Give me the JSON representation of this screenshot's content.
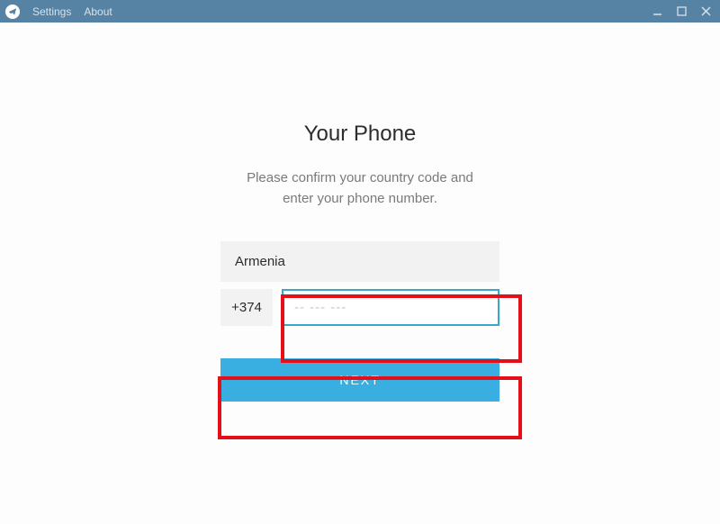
{
  "menu": {
    "settings": "Settings",
    "about": "About"
  },
  "icons": {
    "logo": "paper-plane-icon",
    "minimize": "minimize-icon",
    "maximize": "maximize-icon",
    "close": "close-icon"
  },
  "page": {
    "title": "Your Phone",
    "subtitle_line1": "Please confirm your country code and",
    "subtitle_line2": "enter your phone number."
  },
  "form": {
    "country": "Armenia",
    "code": "+374",
    "phone_value": "",
    "phone_placeholder": "-- --- ---",
    "next_label": "NEXT"
  },
  "colors": {
    "titlebar": "#5682a3",
    "primary_button": "#39aee0",
    "highlight": "#e3101a",
    "input_border_focus": "#37a7d0"
  }
}
